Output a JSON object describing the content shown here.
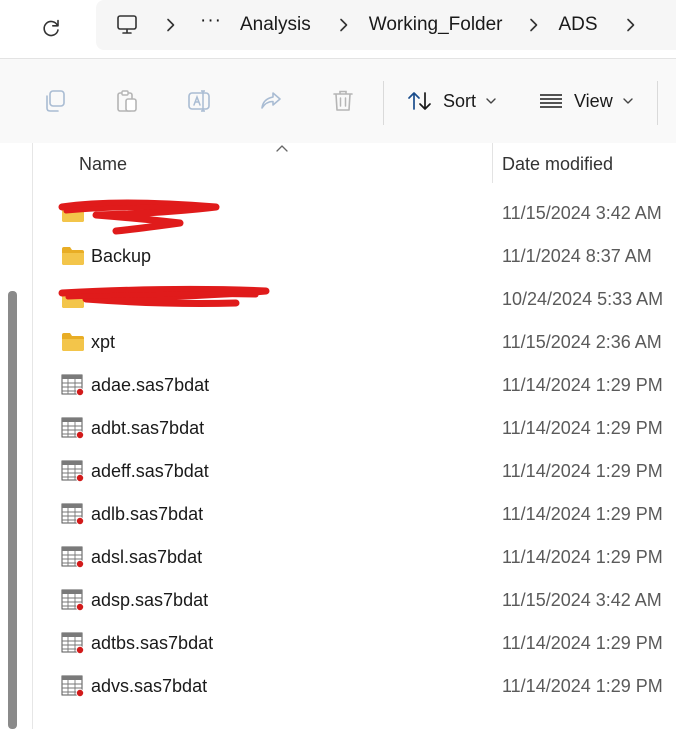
{
  "breadcrumb": {
    "overflow": "···",
    "items": [
      "Analysis",
      "Working_Folder",
      "ADS"
    ]
  },
  "toolbar": {
    "sort_label": "Sort",
    "view_label": "View"
  },
  "columns": {
    "name": "Name",
    "date_modified": "Date modified"
  },
  "files": [
    {
      "name": "",
      "type": "folder",
      "date": "11/15/2024 3:42 AM",
      "redacted": true
    },
    {
      "name": "Backup",
      "type": "folder",
      "date": "11/1/2024 8:37 AM"
    },
    {
      "name": "",
      "type": "folder",
      "date": "10/24/2024 5:33 AM",
      "redacted": true
    },
    {
      "name": "xpt",
      "type": "folder",
      "date": "11/15/2024 2:36 AM"
    },
    {
      "name": "adae.sas7bdat",
      "type": "sas-data",
      "date": "11/14/2024 1:29 PM"
    },
    {
      "name": "adbt.sas7bdat",
      "type": "sas-data",
      "date": "11/14/2024 1:29 PM"
    },
    {
      "name": "adeff.sas7bdat",
      "type": "sas-data",
      "date": "11/14/2024 1:29 PM"
    },
    {
      "name": "adlb.sas7bdat",
      "type": "sas-data",
      "date": "11/14/2024 1:29 PM"
    },
    {
      "name": "adsl.sas7bdat",
      "type": "sas-data",
      "date": "11/14/2024 1:29 PM"
    },
    {
      "name": "adsp.sas7bdat",
      "type": "sas-data",
      "date": "11/15/2024 3:42 AM"
    },
    {
      "name": "adtbs.sas7bdat",
      "type": "sas-data",
      "date": "11/14/2024 1:29 PM"
    },
    {
      "name": "advs.sas7bdat",
      "type": "sas-data",
      "date": "11/14/2024 1:29 PM"
    }
  ],
  "colors": {
    "folder": "#f3c54a",
    "folder_dark": "#e8ad25",
    "redaction": "#e01b1b",
    "scrollbar": "#8a8a8a",
    "toolbar_bg": "#f9f9f9"
  },
  "icons": {
    "refresh": "refresh-icon",
    "monitor": "monitor-icon",
    "copy": "copy-icon",
    "paste": "paste-icon",
    "rename": "rename-icon",
    "share": "share-icon",
    "delete": "delete-icon",
    "sort": "sort-icon",
    "view": "view-icon",
    "folder": "folder-icon",
    "sas_data": "sas-data-file-icon"
  }
}
